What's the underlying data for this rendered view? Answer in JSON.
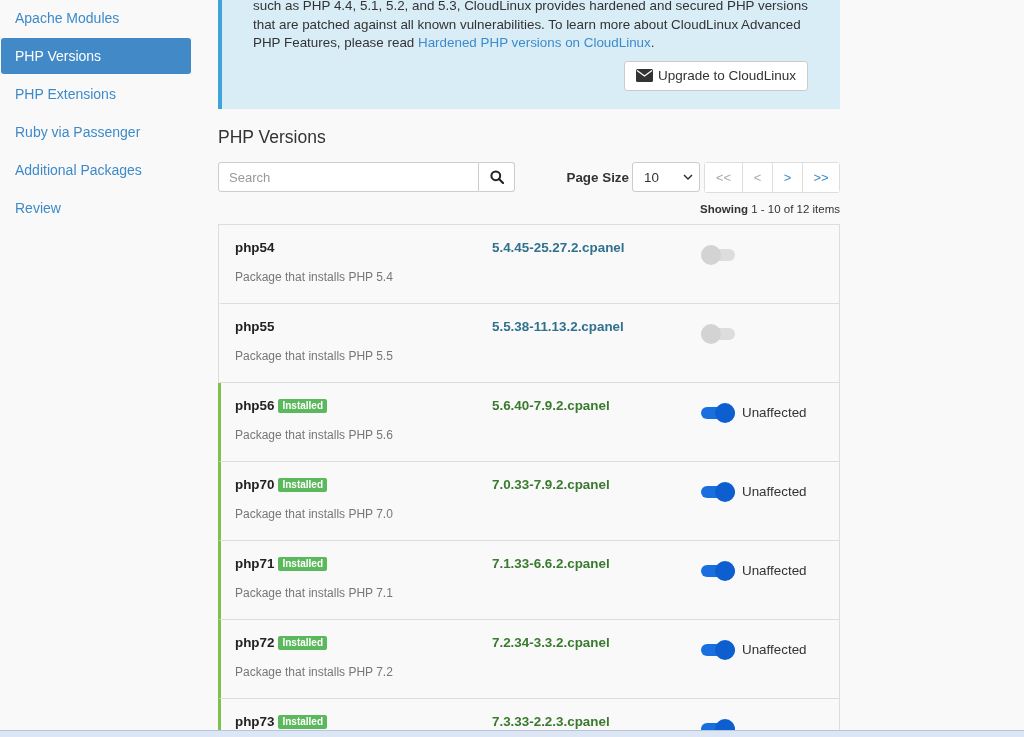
{
  "sidebar": {
    "items": [
      {
        "label": "Apache Modules",
        "selected": false
      },
      {
        "label": "PHP Versions",
        "selected": true
      },
      {
        "label": "PHP Extensions",
        "selected": false
      },
      {
        "label": "Ruby via Passenger",
        "selected": false
      },
      {
        "label": "Additional Packages",
        "selected": false
      },
      {
        "label": "Review",
        "selected": false
      }
    ]
  },
  "notice": {
    "text": "such as PHP 4.4, 5.1, 5.2, and 5.3, CloudLinux provides hardened and secured PHP versions that are patched against all known vulnerabilities. To learn more about CloudLinux Advanced PHP Features, please read ",
    "link": "Hardened PHP versions on CloudLinux",
    "after_link": ".",
    "button": "Upgrade to CloudLinux"
  },
  "section_title": "PHP Versions",
  "search": {
    "placeholder": "Search"
  },
  "page_size": {
    "label": "Page Size",
    "value": "10"
  },
  "pagination": [
    {
      "label": "<<",
      "disabled": true
    },
    {
      "label": "<",
      "disabled": true
    },
    {
      "label": ">",
      "disabled": false
    },
    {
      "label": ">>",
      "disabled": false
    }
  ],
  "showing": "**Showing** 1 - 10 of 12 items",
  "packages": [
    {
      "name": "php54",
      "installed": false,
      "description": "Package that installs PHP 5.4",
      "version": "5.4.45-25.27.2.cpanel",
      "on": false
    },
    {
      "name": "php55",
      "installed": false,
      "description": "Package that installs PHP 5.5",
      "version": "5.5.38-11.13.2.cpanel",
      "on": false
    },
    {
      "name": "php56",
      "installed": true,
      "badge": "Installed",
      "description": "Package that installs PHP 5.6",
      "version": "5.6.40-7.9.2.cpanel",
      "on": true,
      "status": "Unaffected"
    },
    {
      "name": "php70",
      "installed": true,
      "badge": "Installed",
      "description": "Package that installs PHP 7.0",
      "version": "7.0.33-7.9.2.cpanel",
      "on": true,
      "status": "Unaffected"
    },
    {
      "name": "php71",
      "installed": true,
      "badge": "Installed",
      "description": "Package that installs PHP 7.1",
      "version": "7.1.33-6.6.2.cpanel",
      "on": true,
      "status": "Unaffected"
    },
    {
      "name": "php72",
      "installed": true,
      "badge": "Installed",
      "description": "Package that installs PHP 7.2",
      "version": "7.2.34-3.3.2.cpanel",
      "on": true,
      "status": "Unaffected"
    },
    {
      "name": "php73",
      "installed": true,
      "badge": "Installed",
      "version": "7.3.33-2.2.3.cpanel",
      "on": true
    }
  ]
}
